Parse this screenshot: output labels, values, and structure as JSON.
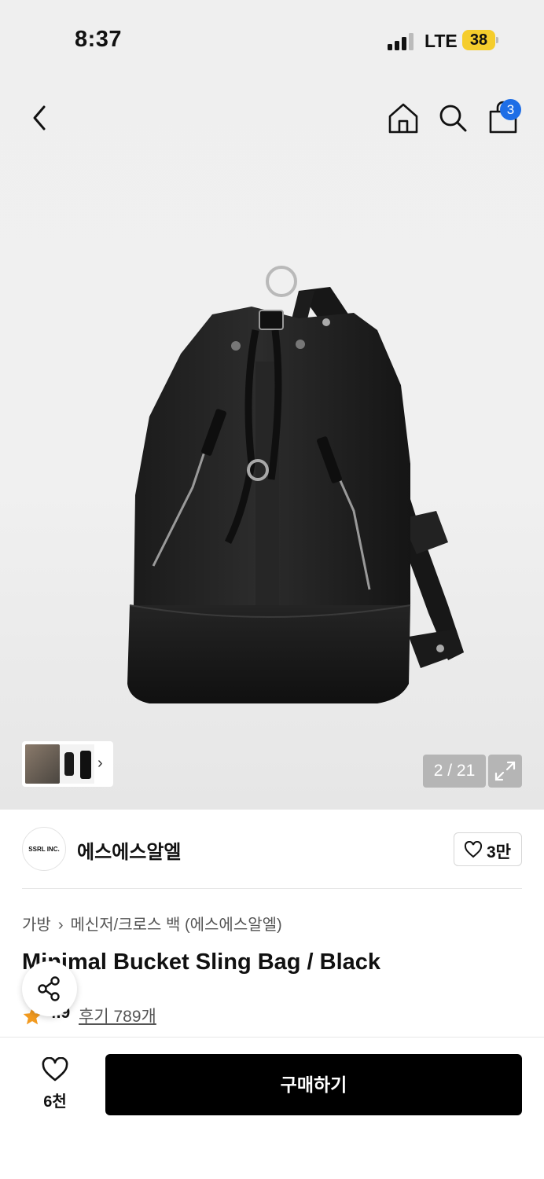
{
  "status_bar": {
    "time": "8:37",
    "network": "LTE",
    "battery": "38"
  },
  "header": {
    "back_icon": "chevron-left-icon",
    "home_icon": "home-icon",
    "search_icon": "search-icon",
    "cart_icon": "shopping-bag-icon",
    "cart_count": "3",
    "cart_badge_color": "#1e6ee6"
  },
  "gallery": {
    "counter": "2 / 21",
    "expand_icon": "expand-icon",
    "thumbs_chevron": "›"
  },
  "brand": {
    "logo_text": "SSRL INC.",
    "name": "에스에스알엘",
    "like_count": "3만"
  },
  "product": {
    "breadcrumb": [
      "가방",
      "메신저/크로스 백 (에스에스알엘)"
    ],
    "breadcrumb_separator": "›",
    "title": "Minimal Bucket Sling Bag / Black",
    "rating": "4.9",
    "reviews": "후기 789개",
    "star_color": "#f29a1f"
  },
  "bottom_bar": {
    "wish_count": "6천",
    "buy_label": "구매하기",
    "buy_color": "#000000"
  }
}
